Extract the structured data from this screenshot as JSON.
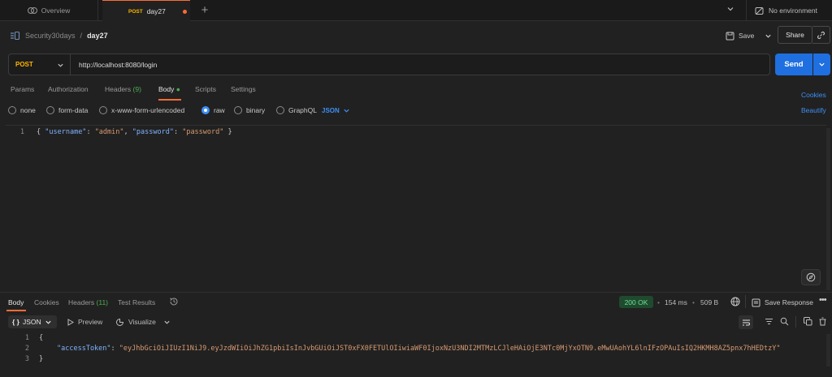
{
  "tabs": {
    "overview_label": "Overview",
    "active_method": "POST",
    "active_name": "day27"
  },
  "environment": {
    "label": "No environment"
  },
  "breadcrumb": {
    "collection": "Security30days",
    "separator": "/",
    "request": "day27"
  },
  "header_actions": {
    "save_label": "Save",
    "share_label": "Share"
  },
  "request": {
    "method": "POST",
    "url": "http://localhost:8080/login",
    "send_label": "Send"
  },
  "request_tabs": {
    "params": "Params",
    "authorization": "Authorization",
    "headers": "Headers",
    "headers_count": "(9)",
    "body": "Body",
    "scripts": "Scripts",
    "settings": "Settings",
    "cookies": "Cookies",
    "beautify": "Beautify"
  },
  "body_types": {
    "none": "none",
    "form_data": "form-data",
    "urlencoded": "x-www-form-urlencoded",
    "raw": "raw",
    "binary": "binary",
    "graphql": "GraphQL",
    "format": "JSON"
  },
  "request_body": {
    "line_no": "1",
    "open": "{ ",
    "k1": "\"username\"",
    "colon1": ": ",
    "v1": "\"admin\"",
    "comma": ", ",
    "k2": "\"password\"",
    "colon2": ": ",
    "v2": "\"password\"",
    "close": " }"
  },
  "response_tabs": {
    "body": "Body",
    "cookies": "Cookies",
    "headers": "Headers",
    "headers_count": "(11)",
    "test_results": "Test Results"
  },
  "response_meta": {
    "status": "200 OK",
    "time": "154 ms",
    "size": "509 B",
    "save_response": "Save Response",
    "more": "•••"
  },
  "response_view": {
    "format": "JSON",
    "format_prefix": "{ }",
    "preview": "Preview",
    "visualize": "Visualize"
  },
  "response_body": {
    "ln1": "1",
    "ln2": "2",
    "ln3": "3",
    "open": "{",
    "key": "\"accessToken\"",
    "colon": ": ",
    "value": "\"eyJhbGciOiJIUzI1NiJ9.eyJzdWIiOiJhZG1pbiIsInJvbGUiOiJST0xFX0FETUlOIiwiaWF0IjoxNzU3NDI2MTMzLCJleHAiOjE3NTc0MjYxOTN9.eMwUAohYL6lnIFzOPAuIsIQ2HKMH8AZ5pnx7hHEDtzY\"",
    "close": "}"
  },
  "colors": {
    "accent": "#ff6c37",
    "send": "#1f6fe0",
    "link": "#3d8ff5",
    "method": "#ffb400",
    "status_ok": "#6ee09a"
  }
}
